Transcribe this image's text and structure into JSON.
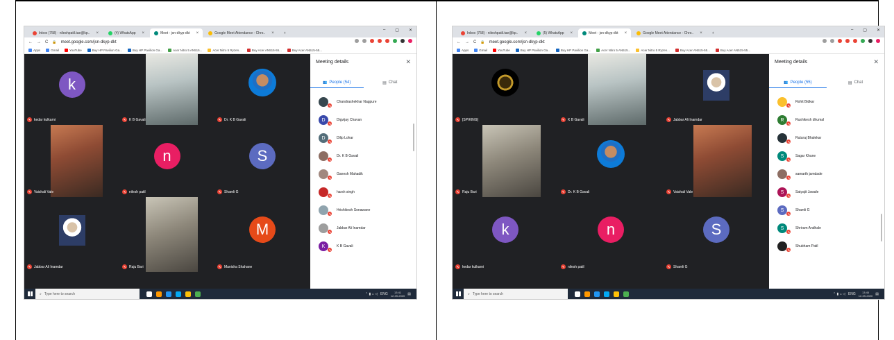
{
  "left": {
    "tabs": [
      {
        "label": "Inbox (758) - nileshpatil.tae@kp..",
        "color": "#ea4335"
      },
      {
        "label": "(4) WhatsApp",
        "color": "#25d366"
      },
      {
        "label": "Meet - jsn-dkyp-dkt",
        "color": "#00897b",
        "active": true
      },
      {
        "label": "Google Meet Attendance - Chro..",
        "color": "#fbbc04"
      }
    ],
    "url": "meet.google.com/jsn-dkyp-dkt",
    "bookmarks": [
      "Apps",
      "Gmail",
      "YouTube",
      "Buy HP Pavilion Ga...",
      "Buy HP Pavilion Ga...",
      "Acer Nitro 5 AN515...",
      "Acer Nitro 5 Ryzen...",
      "Buy Acer AN515-55...",
      "Buy Acer AN515-55..."
    ],
    "tiles": [
      {
        "name": "kedar kulkarni",
        "letter": "k",
        "color": "#7e57c2"
      },
      {
        "name": "K B Gavali",
        "photo": "office"
      },
      {
        "name": "Dr. K B Gavali",
        "photo": "round"
      },
      {
        "name": "Vaishali Vale",
        "photo": "warm"
      },
      {
        "name": "nilesh patil",
        "letter": "n",
        "color": "#e91e63"
      },
      {
        "name": "Shamli G",
        "letter": "S",
        "color": "#5c6bc0"
      },
      {
        "name": "Jabbar Ali Inamdar",
        "photo": "suit"
      },
      {
        "name": "Raju Bari",
        "photo": "plain"
      },
      {
        "name": "Manisha Shahane",
        "letter": "M",
        "color": "#e64a19"
      }
    ],
    "panel": {
      "title": "Meeting details",
      "people_tab": "People (54)",
      "chat_tab": "Chat",
      "people": [
        {
          "name": "Chandrashekhar Nagpure",
          "color": "#37474f"
        },
        {
          "name": "Digvijay Chavan",
          "letter": "D",
          "color": "#3949ab"
        },
        {
          "name": "Dilip Lohar",
          "letter": "D",
          "color": "#546e7a"
        },
        {
          "name": "Dr. K B Gavali",
          "color": "#8d6e63"
        },
        {
          "name": "Ganesh Mahadik",
          "color": "#a1887f"
        },
        {
          "name": "harsh singh",
          "color": "#c62828"
        },
        {
          "name": "Hrishikesh Sonawane",
          "color": "#90a4ae"
        },
        {
          "name": "Jabbar Ali Inamdar",
          "color": "#9e9e9e"
        },
        {
          "name": "K B Gavali",
          "letter": "K",
          "color": "#7b1fa2"
        }
      ]
    },
    "taskbar": {
      "search": "Type here to search",
      "lang": "ENG",
      "time": "13:41",
      "date": "12-09-2020"
    }
  },
  "right": {
    "tabs": [
      {
        "label": "Inbox (758) - nileshpatil.tae@kp..",
        "color": "#ea4335"
      },
      {
        "label": "(5) WhatsApp",
        "color": "#25d366"
      },
      {
        "label": "Meet - jsn-dkyp-dkt",
        "color": "#00897b",
        "active": true
      },
      {
        "label": "Google Meet Attendance - Chro..",
        "color": "#fbbc04"
      }
    ],
    "url": "meet.google.com/jsn-dkyp-dkt",
    "bookmarks": [
      "Apps",
      "Gmail",
      "YouTube",
      "Buy HP Pavilion Ga...",
      "Buy HP Pavilion Ga...",
      "Acer Nitro 5 AN515...",
      "Acer Nitro 5 Ryzen...",
      "Buy Acer AN515-55...",
      "Buy Acer AN515-55..."
    ],
    "tiles": [
      {
        "name": "[SP/KING]",
        "photo": "logo"
      },
      {
        "name": "K B Gavali",
        "photo": "office"
      },
      {
        "name": "Jabbar Ali Inamdar",
        "photo": "suit"
      },
      {
        "name": "Raju Bari",
        "photo": "plain"
      },
      {
        "name": "Dr. K B Gavali",
        "photo": "round"
      },
      {
        "name": "Vaishali Vale",
        "photo": "warm"
      },
      {
        "name": "kedar kulkarni",
        "letter": "k",
        "color": "#7e57c2"
      },
      {
        "name": "nilesh patil",
        "letter": "n",
        "color": "#e91e63"
      },
      {
        "name": "Shamli G",
        "letter": "S",
        "color": "#5c6bc0"
      }
    ],
    "panel": {
      "title": "Meeting details",
      "people_tab": "People (55)",
      "chat_tab": "Chat",
      "people": [
        {
          "name": "Rohit Bidkar",
          "color": "#fbc02d"
        },
        {
          "name": "Rushikesh dhumal",
          "letter": "R",
          "color": "#2e7d32"
        },
        {
          "name": "Ruturaj Bhalekar",
          "color": "#263238"
        },
        {
          "name": "Sagar Khune",
          "letter": "S",
          "color": "#00897b"
        },
        {
          "name": "samarth jamdade",
          "color": "#8d6e63"
        },
        {
          "name": "Satyajit Jawale",
          "letter": "S",
          "color": "#ad1457"
        },
        {
          "name": "Shamli G",
          "letter": "S",
          "color": "#5c6bc0"
        },
        {
          "name": "Shriram Andhale",
          "letter": "S",
          "color": "#00897b"
        },
        {
          "name": "Shubham Patil",
          "color": "#212121"
        }
      ]
    },
    "taskbar": {
      "search": "Type here to search",
      "lang": "ENG",
      "time": "13:45",
      "date": "12-09-2020"
    }
  }
}
